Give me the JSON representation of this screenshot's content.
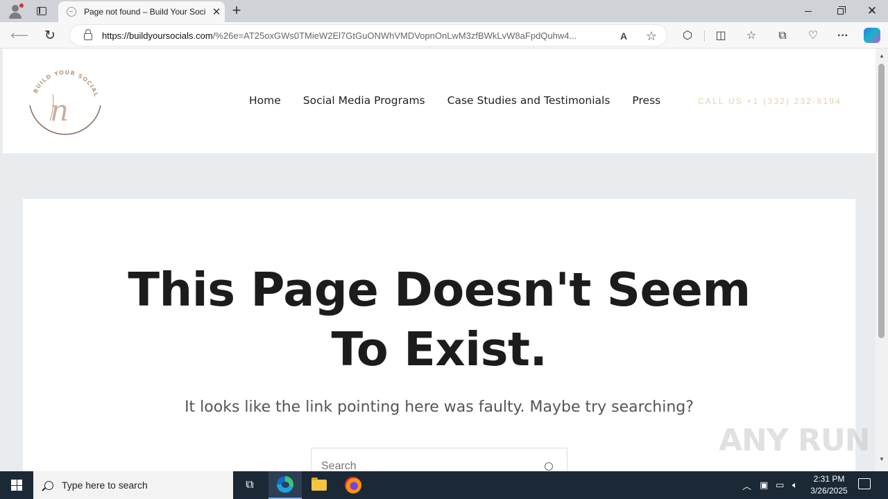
{
  "browser": {
    "tab_title": "Page not found – Build Your Soci",
    "new_tab_symbol": "+",
    "close_symbol": "✕",
    "url_host": "https://buildyoursocials.com",
    "url_rest": "/%26e=AT25oxGWs0TMieW2El7GtGuONWhVMDVopnOnLwM3zfBWkLvW8aFpdQuhw4..."
  },
  "site": {
    "logo_text": "BUILD YOUR SOCIALS",
    "logo_monogram": "n",
    "nav": [
      "Home",
      "Social Media Programs",
      "Case Studies and Testimonials",
      "Press"
    ],
    "call_us": "CALL US +1 (332) 232-8194",
    "heading": "This Page Doesn't Seem To Exist.",
    "subheading": "It looks like the link pointing here was faulty. Maybe try searching?",
    "search_placeholder": "Search"
  },
  "watermark": "ANY RUN",
  "taskbar": {
    "search_placeholder": "Type here to search",
    "time": "2:31 PM",
    "date": "3/26/2025"
  }
}
